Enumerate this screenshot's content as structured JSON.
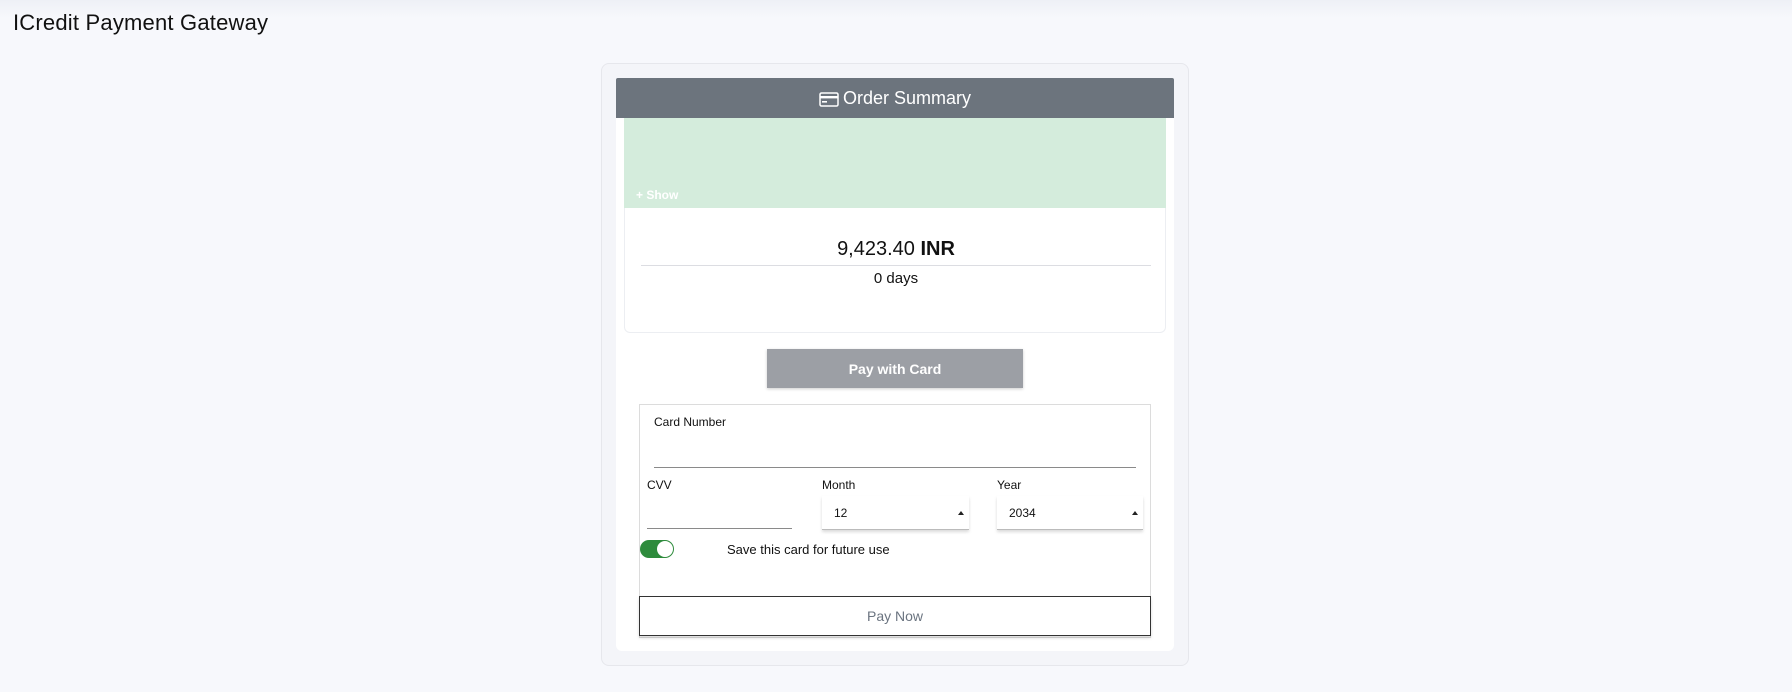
{
  "app": {
    "title": "ICredit Payment Gateway"
  },
  "summary": {
    "header": "Order Summary",
    "show_link": "+ Show",
    "amount": "9,423.40",
    "currency": "INR",
    "days": "0 days"
  },
  "payment": {
    "pay_with_card_label": "Pay with Card",
    "card_number_label": "Card Number",
    "card_number_value": "",
    "cvv_label": "CVV",
    "cvv_value": "",
    "month_label": "Month",
    "month_value": "12",
    "year_label": "Year",
    "year_value": "2034",
    "save_card_label": "Save this card for future use",
    "save_card_enabled": true,
    "pay_now_label": "Pay Now"
  },
  "colors": {
    "header_bg": "#6c747d",
    "green_area": "#d4ecdc",
    "toggle_on": "#2e8b3c",
    "pay_card_button": "#9c9fa5"
  },
  "icons": {
    "header_icon": "credit-card-icon",
    "select_caret": "caret-up-icon"
  }
}
